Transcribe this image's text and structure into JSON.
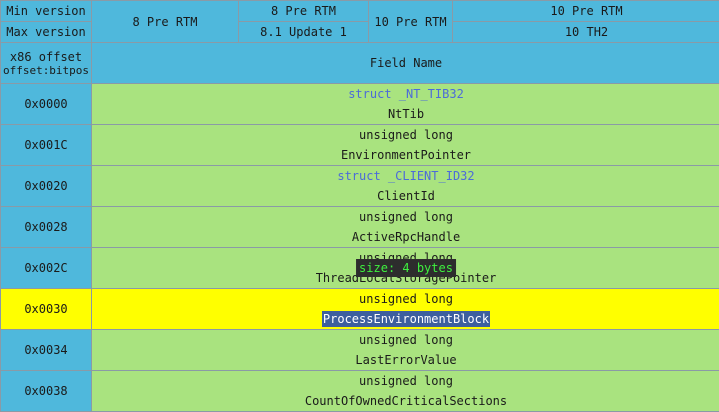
{
  "header": {
    "min_version_label": "Min version",
    "max_version_label": "Max version",
    "offset_label": "x86 offset",
    "offset_sub_label": "offset:bitpos",
    "field_name_label": "Field Name",
    "col1": "8 Pre RTM",
    "col2_min": "8 Pre RTM",
    "col2_max": "8.1 Update 1",
    "col3": "10 Pre RTM",
    "col4_min": "10 Pre RTM",
    "col4_max": "10 TH2"
  },
  "rows": [
    {
      "offset": "0x0000",
      "type": "struct _NT_TIB32",
      "name": "NtTib"
    },
    {
      "offset": "0x001C",
      "type": "unsigned long",
      "name": "EnvironmentPointer"
    },
    {
      "offset": "0x0020",
      "type": "struct _CLIENT_ID32",
      "name": "ClientId"
    },
    {
      "offset": "0x0028",
      "type": "unsigned long",
      "name": "ActiveRpcHandle"
    },
    {
      "offset": "0x002C",
      "type": "unsigned long",
      "name": "ThreadLocalStoragePointer"
    },
    {
      "offset": "0x0030",
      "type": "unsigned long",
      "name": "ProcessEnvironmentBlock"
    },
    {
      "offset": "0x0034",
      "type": "unsigned long",
      "name": "LastErrorValue"
    },
    {
      "offset": "0x0038",
      "type": "unsigned long",
      "name": "CountOfOwnedCriticalSections"
    }
  ],
  "tooltip": {
    "text": "size: 4 bytes"
  },
  "colors": {
    "header_bg": "#4fb8dc",
    "field_bg": "#a9e37f",
    "highlight_bg": "#ffff00",
    "link_type": "#4c6bd9",
    "selection_bg": "#3d5f9e",
    "tooltip_bg": "#2d2d2d",
    "tooltip_text": "#3ef03e"
  }
}
